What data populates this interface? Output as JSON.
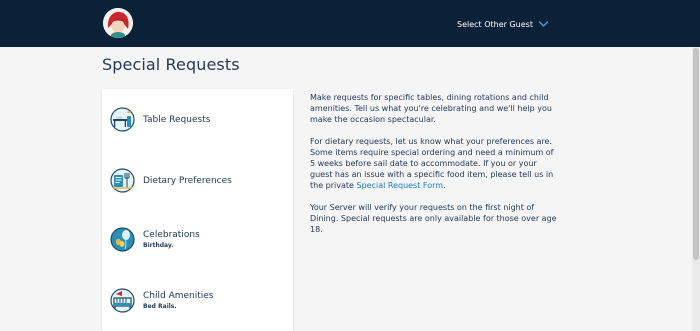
{
  "header": {
    "guest_select_label": "Select Other Guest",
    "colors": {
      "bar": "#0b2137",
      "accent": "#45a3d6"
    }
  },
  "page": {
    "title": "Special Requests"
  },
  "requests": [
    {
      "label": "Table Requests",
      "sub": "",
      "icon": "dining-table-icon"
    },
    {
      "label": "Dietary Preferences",
      "sub": "",
      "icon": "food-plate-icon"
    },
    {
      "label": "Celebrations",
      "sub": "Birthday.",
      "icon": "balloons-icon"
    },
    {
      "label": "Child Amenities",
      "sub": "Bed Rails.",
      "icon": "crib-icon"
    }
  ],
  "info": {
    "p1": "Make requests for specific tables, dining rotations and child amenities. Tell us what you're celebrating and we'll help you make the occasion spectacular.",
    "p2_before_link": "For dietary requests, let us know what your preferences are. Some items require special ordering and need a minimum of 5 weeks before sail date to accommodate. If you or your guest has an issue with a specific food item, please tell us in the private ",
    "p2_link": "Special Request Form",
    "p2_after_link": ".",
    "p3": "Your Server will verify your requests on the first night of Dining. Special requests are only available for those over age 18."
  }
}
